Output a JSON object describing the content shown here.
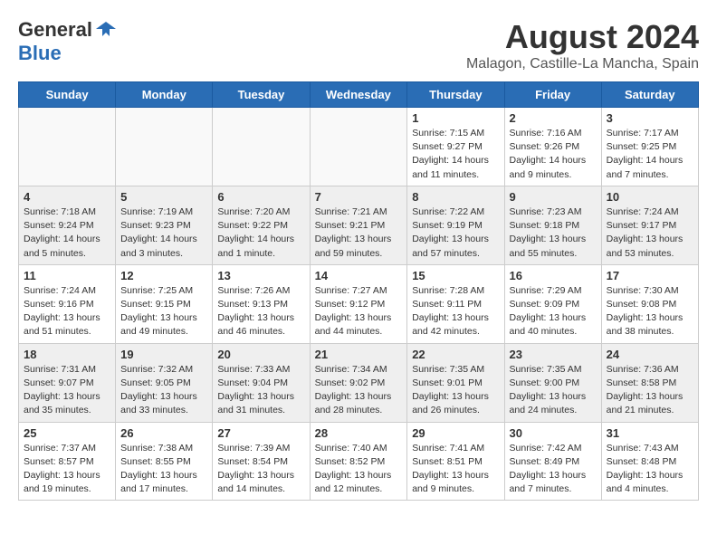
{
  "header": {
    "logo_general": "General",
    "logo_blue": "Blue",
    "month": "August 2024",
    "location": "Malagon, Castille-La Mancha, Spain"
  },
  "weekdays": [
    "Sunday",
    "Monday",
    "Tuesday",
    "Wednesday",
    "Thursday",
    "Friday",
    "Saturday"
  ],
  "weeks": [
    [
      {
        "day": "",
        "info": ""
      },
      {
        "day": "",
        "info": ""
      },
      {
        "day": "",
        "info": ""
      },
      {
        "day": "",
        "info": ""
      },
      {
        "day": "1",
        "info": "Sunrise: 7:15 AM\nSunset: 9:27 PM\nDaylight: 14 hours\nand 11 minutes."
      },
      {
        "day": "2",
        "info": "Sunrise: 7:16 AM\nSunset: 9:26 PM\nDaylight: 14 hours\nand 9 minutes."
      },
      {
        "day": "3",
        "info": "Sunrise: 7:17 AM\nSunset: 9:25 PM\nDaylight: 14 hours\nand 7 minutes."
      }
    ],
    [
      {
        "day": "4",
        "info": "Sunrise: 7:18 AM\nSunset: 9:24 PM\nDaylight: 14 hours\nand 5 minutes."
      },
      {
        "day": "5",
        "info": "Sunrise: 7:19 AM\nSunset: 9:23 PM\nDaylight: 14 hours\nand 3 minutes."
      },
      {
        "day": "6",
        "info": "Sunrise: 7:20 AM\nSunset: 9:22 PM\nDaylight: 14 hours\nand 1 minute."
      },
      {
        "day": "7",
        "info": "Sunrise: 7:21 AM\nSunset: 9:21 PM\nDaylight: 13 hours\nand 59 minutes."
      },
      {
        "day": "8",
        "info": "Sunrise: 7:22 AM\nSunset: 9:19 PM\nDaylight: 13 hours\nand 57 minutes."
      },
      {
        "day": "9",
        "info": "Sunrise: 7:23 AM\nSunset: 9:18 PM\nDaylight: 13 hours\nand 55 minutes."
      },
      {
        "day": "10",
        "info": "Sunrise: 7:24 AM\nSunset: 9:17 PM\nDaylight: 13 hours\nand 53 minutes."
      }
    ],
    [
      {
        "day": "11",
        "info": "Sunrise: 7:24 AM\nSunset: 9:16 PM\nDaylight: 13 hours\nand 51 minutes."
      },
      {
        "day": "12",
        "info": "Sunrise: 7:25 AM\nSunset: 9:15 PM\nDaylight: 13 hours\nand 49 minutes."
      },
      {
        "day": "13",
        "info": "Sunrise: 7:26 AM\nSunset: 9:13 PM\nDaylight: 13 hours\nand 46 minutes."
      },
      {
        "day": "14",
        "info": "Sunrise: 7:27 AM\nSunset: 9:12 PM\nDaylight: 13 hours\nand 44 minutes."
      },
      {
        "day": "15",
        "info": "Sunrise: 7:28 AM\nSunset: 9:11 PM\nDaylight: 13 hours\nand 42 minutes."
      },
      {
        "day": "16",
        "info": "Sunrise: 7:29 AM\nSunset: 9:09 PM\nDaylight: 13 hours\nand 40 minutes."
      },
      {
        "day": "17",
        "info": "Sunrise: 7:30 AM\nSunset: 9:08 PM\nDaylight: 13 hours\nand 38 minutes."
      }
    ],
    [
      {
        "day": "18",
        "info": "Sunrise: 7:31 AM\nSunset: 9:07 PM\nDaylight: 13 hours\nand 35 minutes."
      },
      {
        "day": "19",
        "info": "Sunrise: 7:32 AM\nSunset: 9:05 PM\nDaylight: 13 hours\nand 33 minutes."
      },
      {
        "day": "20",
        "info": "Sunrise: 7:33 AM\nSunset: 9:04 PM\nDaylight: 13 hours\nand 31 minutes."
      },
      {
        "day": "21",
        "info": "Sunrise: 7:34 AM\nSunset: 9:02 PM\nDaylight: 13 hours\nand 28 minutes."
      },
      {
        "day": "22",
        "info": "Sunrise: 7:35 AM\nSunset: 9:01 PM\nDaylight: 13 hours\nand 26 minutes."
      },
      {
        "day": "23",
        "info": "Sunrise: 7:35 AM\nSunset: 9:00 PM\nDaylight: 13 hours\nand 24 minutes."
      },
      {
        "day": "24",
        "info": "Sunrise: 7:36 AM\nSunset: 8:58 PM\nDaylight: 13 hours\nand 21 minutes."
      }
    ],
    [
      {
        "day": "25",
        "info": "Sunrise: 7:37 AM\nSunset: 8:57 PM\nDaylight: 13 hours\nand 19 minutes."
      },
      {
        "day": "26",
        "info": "Sunrise: 7:38 AM\nSunset: 8:55 PM\nDaylight: 13 hours\nand 17 minutes."
      },
      {
        "day": "27",
        "info": "Sunrise: 7:39 AM\nSunset: 8:54 PM\nDaylight: 13 hours\nand 14 minutes."
      },
      {
        "day": "28",
        "info": "Sunrise: 7:40 AM\nSunset: 8:52 PM\nDaylight: 13 hours\nand 12 minutes."
      },
      {
        "day": "29",
        "info": "Sunrise: 7:41 AM\nSunset: 8:51 PM\nDaylight: 13 hours\nand 9 minutes."
      },
      {
        "day": "30",
        "info": "Sunrise: 7:42 AM\nSunset: 8:49 PM\nDaylight: 13 hours\nand 7 minutes."
      },
      {
        "day": "31",
        "info": "Sunrise: 7:43 AM\nSunset: 8:48 PM\nDaylight: 13 hours\nand 4 minutes."
      }
    ]
  ]
}
